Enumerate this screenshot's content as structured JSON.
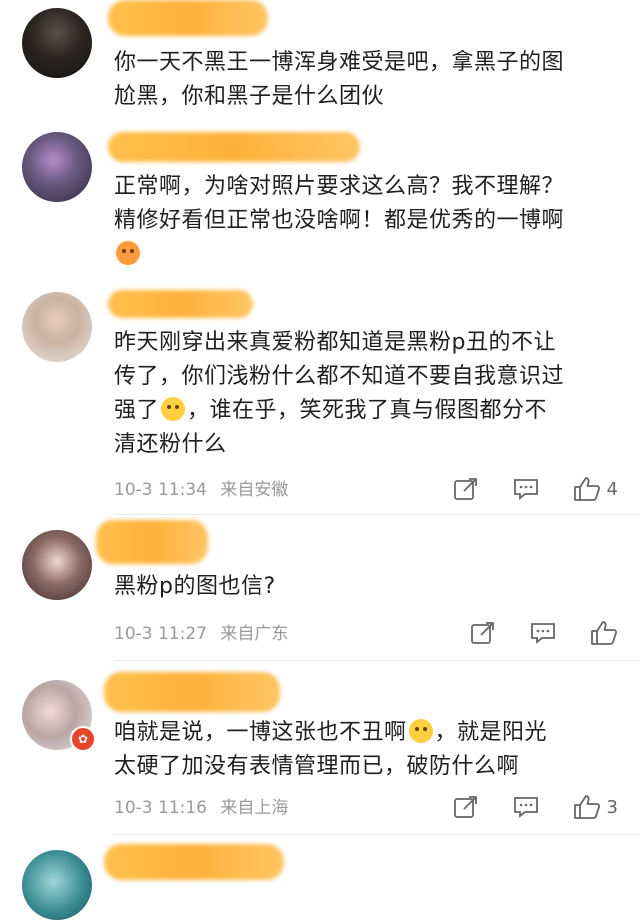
{
  "comments": [
    {
      "text": "你一天不黑王一博浑身难受是吧，拿黑子的图尬黑，你和黑子是什么团伙",
      "line1": "你一天不黑王一博浑身难受是吧，拿黑子的图",
      "line2": "尬黑，你和黑子是什么团伙"
    },
    {
      "line1": "正常啊，为啥对照片要求这么高？我不理解？",
      "line2": "精修好看但正常也没啥啊！都是优秀的一博啊",
      "emoji": "hug-emoji"
    },
    {
      "line1": "昨天刚穿出来真爱粉都知道是黑粉p丑的不让",
      "line2": "传了，你们浅粉什么都不知道不要自我意识过",
      "line3a": "强了",
      "line3b": "，谁在乎，笑死我了真与假图都分不",
      "line4": "清还粉什么",
      "time": "10-3 11:34",
      "location": "来自安徽",
      "likes": "4"
    },
    {
      "line1": "黑粉p的图也信?",
      "time": "10-3 11:27",
      "location": "来自广东",
      "likes": ""
    },
    {
      "line1a": "咱就是说，一博这张也不丑啊",
      "line1b": "，就是阳光",
      "line2": "太硬了加没有表情管理而已，破防什么啊",
      "time": "10-3 11:16",
      "location": "来自上海",
      "likes": "3"
    }
  ],
  "icons": {
    "share": "share-icon",
    "reply": "comment-icon",
    "like": "thumbs-up-icon"
  },
  "colors": {
    "name_highlight": "#ffb13a",
    "meta_text": "#9a9a9a",
    "badge": "#e8432b"
  }
}
